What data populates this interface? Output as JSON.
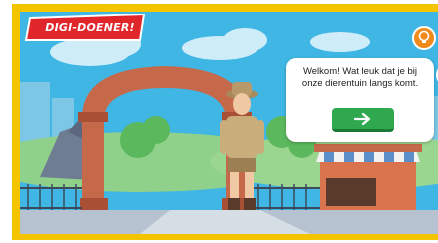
{
  "badge": {
    "label": "DIGI-DOENER!"
  },
  "dialog": {
    "text": "Welkom! Wat leuk dat je bij onze dierentuin langs komt."
  },
  "icons": {
    "hint": "lightbulb-icon",
    "next": "arrow-right-icon"
  },
  "colors": {
    "frame": "#f5c400",
    "badge": "#e0262b",
    "button": "#2fa84f",
    "hint": "#f08a1c",
    "sky": "#3fb6e4"
  }
}
